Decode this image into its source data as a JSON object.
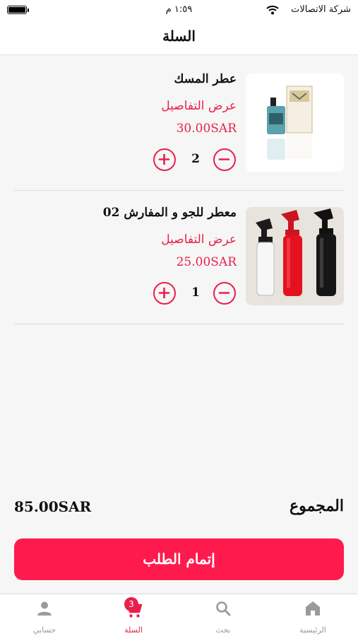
{
  "status_bar": {
    "time": "١:٥٩ م",
    "carrier": "شركة الاتصالات"
  },
  "header": {
    "title": "السلة"
  },
  "cart": {
    "items": [
      {
        "name": "عطر المسك",
        "details_label": "عرض التفاصيل",
        "price": "30.00SAR",
        "quantity": "2",
        "image": "perfume-bottle"
      },
      {
        "name": "معطر للجو و المفارش 02",
        "details_label": "عرض التفاصيل",
        "price": "25.00SAR",
        "quantity": "1",
        "image": "spray-bottles"
      }
    ]
  },
  "summary": {
    "total_label": "المجموع",
    "total_amount": "85.00SAR"
  },
  "checkout_label": "إتمام الطلب",
  "tabbar": {
    "tabs": [
      {
        "label": "الرئيسية",
        "icon": "home-icon"
      },
      {
        "label": "بحث",
        "icon": "search-icon"
      },
      {
        "label": "السلة",
        "icon": "cart-icon",
        "badge": "3",
        "active": true
      },
      {
        "label": "حسابي",
        "icon": "account-icon"
      }
    ]
  },
  "colors": {
    "accent": "#e8204a",
    "button": "#ff1a4d",
    "background": "#f6f6f6"
  }
}
